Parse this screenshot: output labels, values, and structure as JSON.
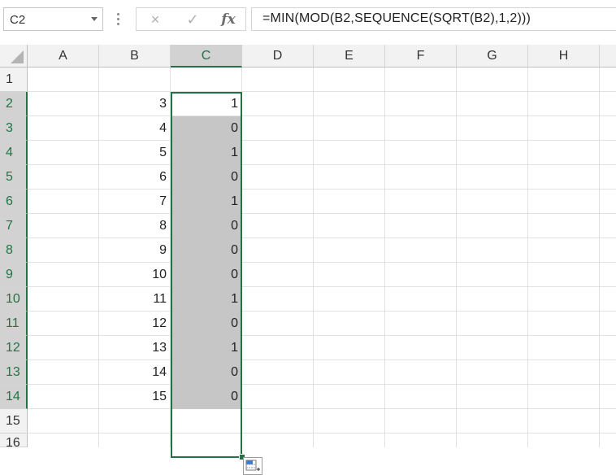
{
  "name_box": {
    "value": "C2"
  },
  "formula_bar": {
    "cancel_icon": "×",
    "enter_icon": "✓",
    "fx_label": "fx",
    "formula": "=MIN(MOD(B2,SEQUENCE(SQRT(B2),1,2)))"
  },
  "columns": [
    "A",
    "B",
    "C",
    "D",
    "E",
    "F",
    "G",
    "H"
  ],
  "rows": [
    "1",
    "2",
    "3",
    "4",
    "5",
    "6",
    "7",
    "8",
    "9",
    "10",
    "11",
    "12",
    "13",
    "14",
    "15",
    "16"
  ],
  "selected_column": "C",
  "column_b_values": [
    "",
    "3",
    "4",
    "5",
    "6",
    "7",
    "8",
    "9",
    "10",
    "11",
    "12",
    "13",
    "14",
    "15"
  ],
  "column_c_values": [
    "",
    "1",
    "0",
    "1",
    "0",
    "1",
    "0",
    "0",
    "0",
    "1",
    "0",
    "1",
    "0",
    "0"
  ],
  "colors": {
    "accent": "#217346",
    "spill_fill": "#c6c6c6",
    "header_bg": "#f2f2f2"
  },
  "icons": {
    "name_box_dropdown": "chevron-down-icon",
    "quick_analysis": "quick-analysis-icon"
  }
}
